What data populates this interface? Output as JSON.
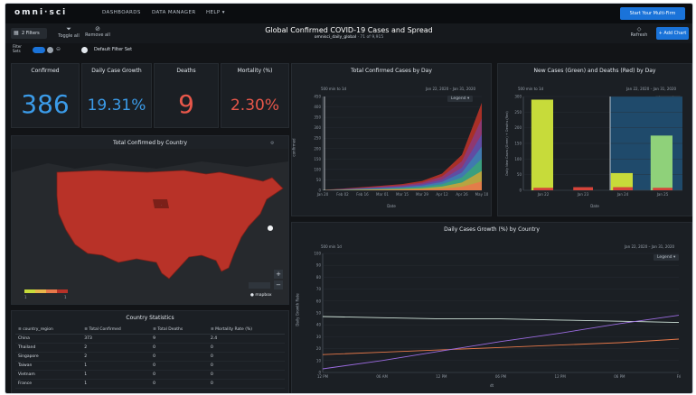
{
  "app": {
    "logo": "omni·sci",
    "nav": [
      "DASHBOARDS",
      "DATA MANAGER",
      "HELP ▾"
    ],
    "trial_button": "Start Your Multi-Firm"
  },
  "titlebar": {
    "filters": "2 Filters",
    "toggle_all": "Toggle all",
    "remove_all": "Remove all",
    "title": "Global Confirmed COVID-19 Cases and Spread",
    "subtitle_table": "omnisci_daily_global",
    "subtitle_rows": "· 71 of 9,915",
    "refresh": "Refresh",
    "add_chart": "+ Add Chart"
  },
  "filterbar": {
    "filter_sets_label": "Filter Sets",
    "default_set": "Default Filter Set"
  },
  "kpis": [
    {
      "label": "Confirmed",
      "value": "386",
      "color": "#3b9be8"
    },
    {
      "label": "Daily Case Growth",
      "value": "19.31%",
      "color": "#3b9be8"
    },
    {
      "label": "Deaths",
      "value": "9",
      "color": "#e8574a"
    },
    {
      "label": "Mortality (%)",
      "value": "2.30%",
      "color": "#e8574a"
    }
  ],
  "map": {
    "title": "Total Confirmed by Country",
    "zoom_label": "Zoom to",
    "attribution": "mapbox",
    "scale_min": "1",
    "scale_max": "1"
  },
  "stats": {
    "title": "Country Statistics",
    "columns": [
      "≡ country_region",
      "≡ Total Confirmed",
      "≡ Total Deaths",
      "≡ Mortality Rate (%)"
    ],
    "rows": [
      [
        "China",
        "373",
        "9",
        "2.4"
      ],
      [
        "Thailand",
        "2",
        "0",
        "0"
      ],
      [
        "Singapore",
        "2",
        "0",
        "0"
      ],
      [
        "Taiwan",
        "1",
        "0",
        "0"
      ],
      [
        "Vietnam",
        "1",
        "0",
        "0"
      ],
      [
        "France",
        "1",
        "0",
        "0"
      ]
    ]
  },
  "charts": {
    "total": {
      "title": "Total Confirmed Cases by Day",
      "legend": "Legend ▾",
      "range": "Jan 22, 2020 – Jan 31, 2020",
      "xlabel": "Date",
      "ylabel": "confirmed",
      "bin": "500 min to 1d"
    },
    "new_cases": {
      "title": "New Cases (Green) and Deaths (Red) by Day",
      "legend": "Legend ▾",
      "range": "Jan 22, 2020 – Jan 31, 2020",
      "xlabel": "Date",
      "ylabel": "Daily New Cases (Green) + Deaths (Red)",
      "bin": "500 min to 1d"
    },
    "growth": {
      "title": "Daily Cases Growth (%) by Country",
      "legend": "Legend ▾",
      "range": "Jan 22, 2020 – Jan 31, 2020",
      "xlabel": "dt",
      "ylabel": "Daily Growth Rate",
      "bin": "500 min 1d"
    }
  },
  "chart_data": [
    {
      "type": "area",
      "title": "Total Confirmed Cases by Day",
      "xlabel": "Date",
      "ylabel": "confirmed",
      "x": [
        "Jan 20",
        "Feb 02",
        "Feb 16",
        "Mar 01",
        "Mar 15",
        "Mar 29",
        "Apr 12",
        "Apr 26",
        "May 10"
      ],
      "ylim": [
        0,
        450
      ],
      "series": [
        {
          "values": [
            2,
            8,
            15,
            22,
            30,
            45,
            80,
            170,
            420
          ]
        }
      ]
    },
    {
      "type": "bar",
      "title": "New Cases (Green) and Deaths (Red) by Day",
      "xlabel": "Date",
      "ylabel": "Daily New Cases (Green) + Deaths (Red)",
      "categories": [
        "Jan 22",
        "Jan 23",
        "Jan 24",
        "Jan 25"
      ],
      "ylim": [
        0,
        300
      ],
      "series": [
        {
          "values": [
            290,
            0,
            55,
            175
          ]
        },
        {
          "values": [
            8,
            10,
            10,
            8
          ]
        }
      ]
    },
    {
      "type": "line",
      "title": "Daily Cases Growth (%) by Country",
      "xlabel": "dt",
      "ylabel": "Daily Growth Rate",
      "x": [
        "12 PM",
        "06 AM",
        "12 PM",
        "06 PM",
        "12 PM",
        "06 PM",
        "Fri"
      ],
      "ylim": [
        0,
        100
      ],
      "series": [
        {
          "values": [
            47,
            46,
            45,
            45,
            44,
            43,
            42
          ]
        },
        {
          "values": [
            15,
            17,
            19,
            21,
            23,
            25,
            28
          ]
        },
        {
          "values": [
            3,
            10,
            18,
            26,
            33,
            41,
            48
          ]
        }
      ]
    }
  ]
}
